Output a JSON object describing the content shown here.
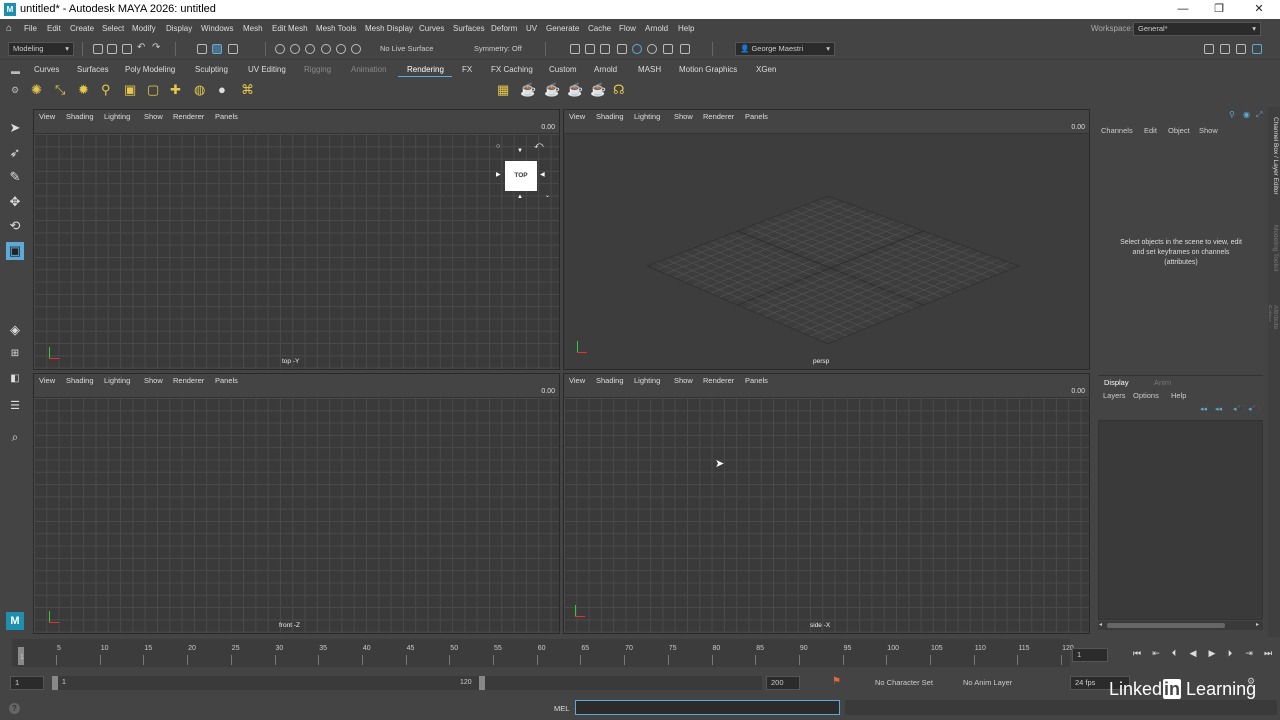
{
  "window": {
    "title": "untitled* - Autodesk MAYA 2026: untitled",
    "app_icon": "M",
    "minimize": "—",
    "maximize": "❐",
    "close": "✕"
  },
  "menubar": {
    "items": [
      "File",
      "Edit",
      "Create",
      "Select",
      "Modify",
      "Display",
      "Windows",
      "Mesh",
      "Edit Mesh",
      "Mesh Tools",
      "Mesh Display",
      "Curves",
      "Surfaces",
      "Deform",
      "UV",
      "Generate",
      "Cache",
      "Flow",
      "Arnold",
      "Help"
    ],
    "workspace_label": "Workspace:",
    "workspace_value": "General*"
  },
  "statusline": {
    "mode": "Modeling",
    "live_surface": "No Live Surface",
    "symmetry": "Symmetry: Off",
    "user": "George Maestri"
  },
  "shelf": {
    "tabs": [
      "Curves",
      "Surfaces",
      "Poly Modeling",
      "Sculpting",
      "UV Editing",
      "Rigging",
      "Animation",
      "Rendering",
      "FX",
      "FX Caching",
      "Custom",
      "Arnold",
      "MASH",
      "Motion Graphics",
      "XGen"
    ],
    "active_tab": "Rendering"
  },
  "viewport_menu": [
    "View",
    "Shading",
    "Lighting",
    "Show",
    "Renderer",
    "Panels"
  ],
  "viewports": [
    {
      "label": "top -Y",
      "value": "0.00"
    },
    {
      "label": "persp",
      "value": "0.00"
    },
    {
      "label": "front -Z",
      "value": "0.00"
    },
    {
      "label": "side -X",
      "value": "0.00"
    }
  ],
  "viewcube": {
    "face": "TOP"
  },
  "channelbox": {
    "menu": [
      "Channels",
      "Edit",
      "Object",
      "Show"
    ],
    "message": "Select objects in the scene to view, edit and set keyframes on channels (attributes)"
  },
  "layereditor": {
    "tabs": [
      "Display",
      "Anim"
    ],
    "menu": [
      "Layers",
      "Options",
      "Help"
    ]
  },
  "side_tabs": [
    "Channel Box / Layer Editor",
    "Modeling Toolkit",
    "Attribute Editor"
  ],
  "timeline": {
    "ticks": [
      "5",
      "10",
      "15",
      "20",
      "25",
      "30",
      "35",
      "40",
      "45",
      "50",
      "55",
      "60",
      "65",
      "70",
      "75",
      "80",
      "85",
      "90",
      "95",
      "100",
      "105",
      "110",
      "115",
      "120"
    ],
    "first_tick": "1",
    "current_frame": "1"
  },
  "range": {
    "start": "1",
    "playback_start": "1",
    "playback_end": "120",
    "end": "200",
    "character_set": "No Character Set",
    "anim_layer": "No Anim Layer",
    "fps": "24 fps"
  },
  "cmdline": {
    "label": "MEL"
  },
  "watermark": {
    "text1": "Linked",
    "text2": "in",
    "text3": " Learning"
  },
  "colors": {
    "accent": "#5fa9d6",
    "viewport_bg": "#3a3a3a",
    "panel_bg": "#444444"
  }
}
